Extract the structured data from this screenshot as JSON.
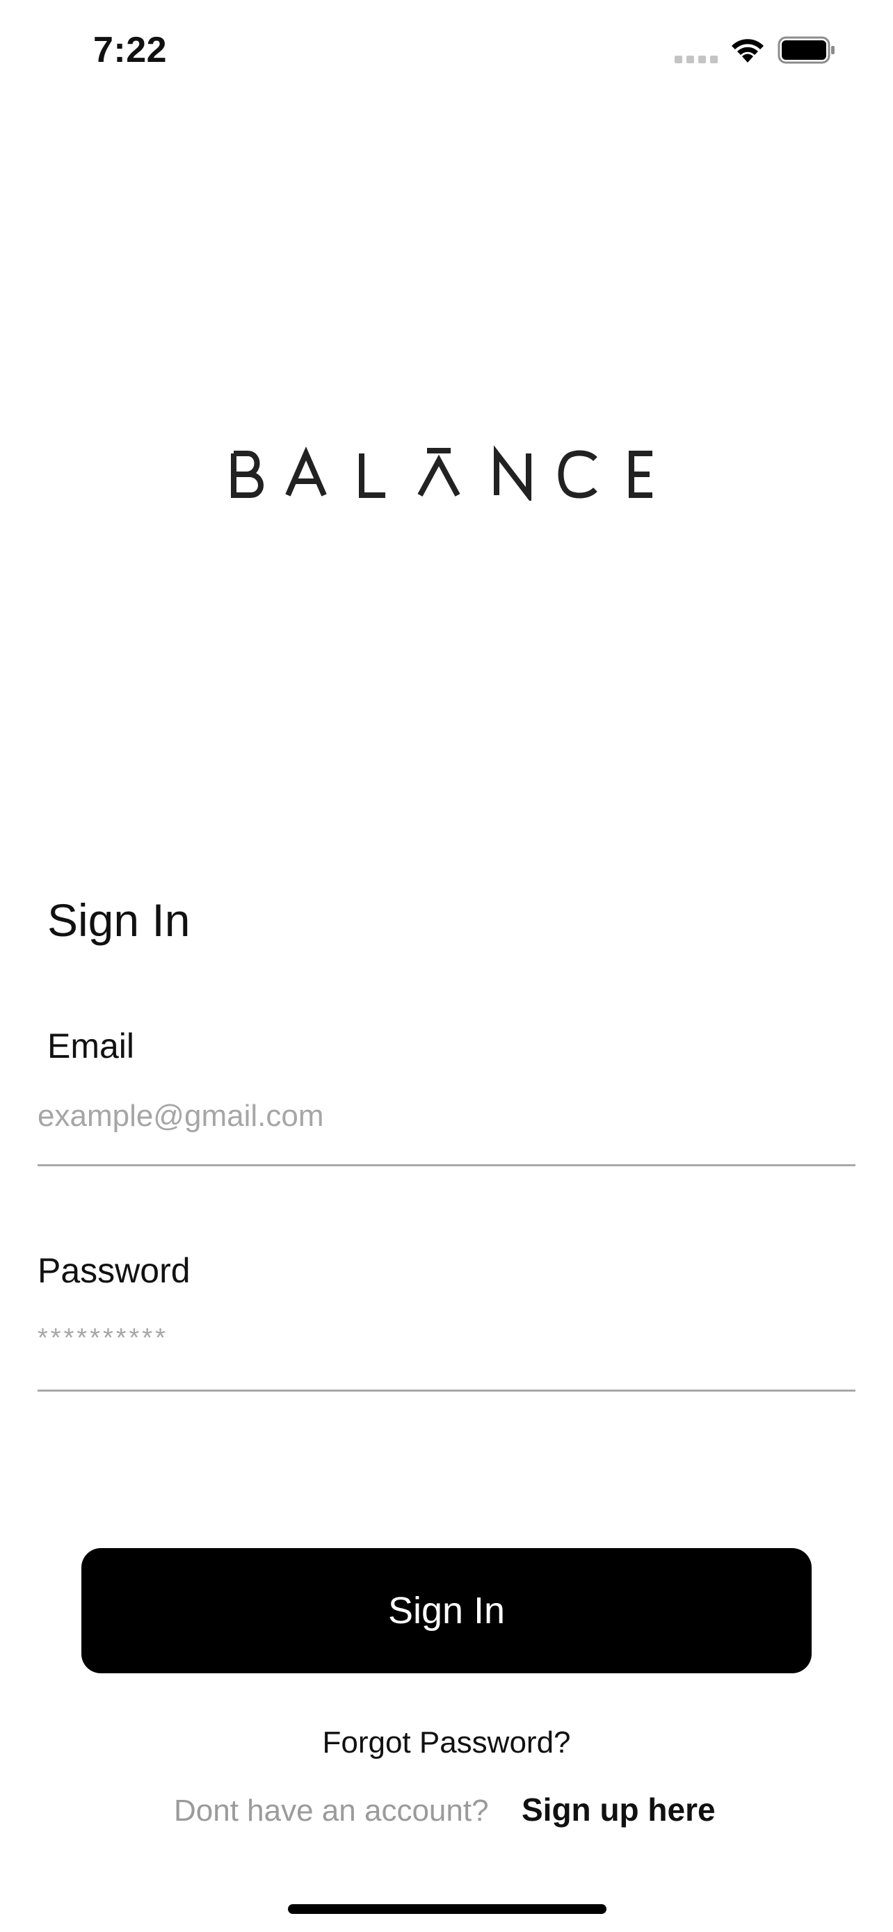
{
  "status_bar": {
    "time": "7:22",
    "signal_icon": "cellular-signal-dots-icon",
    "wifi_icon": "wifi-icon",
    "battery_icon": "battery-full-icon"
  },
  "brand": {
    "logo_text": "BALANCE"
  },
  "form": {
    "title": "Sign In",
    "email": {
      "label": "Email",
      "placeholder": "example@gmail.com",
      "value": ""
    },
    "password": {
      "label": "Password",
      "placeholder": "**********",
      "value": ""
    },
    "submit_label": "Sign In"
  },
  "footer": {
    "forgot_label": "Forgot Password?",
    "no_account_text": "Dont have an account?",
    "signup_label": "Sign up here"
  },
  "colors": {
    "primary_button": "#000000",
    "placeholder": "#a6a6a6",
    "muted_text": "#9b9b9b",
    "divider": "#a8a8a8"
  }
}
